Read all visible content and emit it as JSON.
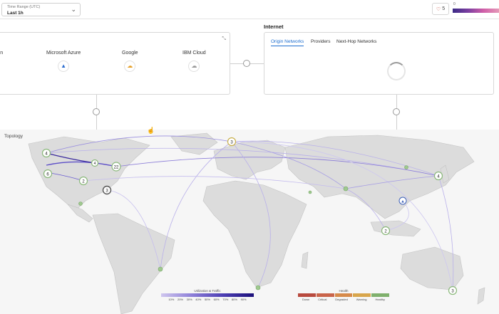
{
  "header": {
    "time_range": {
      "label": "Time Range (UTC)",
      "value": "Last 1h"
    },
    "favorites_count": "5",
    "legend_start": "0"
  },
  "clouds": {
    "items": [
      {
        "name": "Amazon",
        "display": "azon"
      },
      {
        "name": "Microsoft Azure",
        "display": "Microsoft Azure"
      },
      {
        "name": "Google",
        "display": "Google"
      },
      {
        "name": "IBM Cloud",
        "display": "IBM Cloud"
      }
    ]
  },
  "internet": {
    "title": "Internet",
    "tabs": [
      "Origin Networks",
      "Providers",
      "Next-Hop Networks"
    ],
    "active_tab": "Origin Networks"
  },
  "topology": {
    "label": "Topology",
    "nodes": [
      {
        "label": "4",
        "color": "#8ab87a"
      },
      {
        "label": "3",
        "color": "#c9b04c"
      },
      {
        "label": "22",
        "color": "#8ab87a"
      },
      {
        "label": "2",
        "color": "#8ab87a"
      },
      {
        "label": "6",
        "color": "#8ab87a"
      },
      {
        "label": "3",
        "color": "#555555"
      },
      {
        "label": "4",
        "color": "#8ab87a"
      },
      {
        "label": "2",
        "color": "#8ab87a"
      },
      {
        "label": "3",
        "color": "#8ab87a"
      },
      {
        "label": "4",
        "color": "#8ab87a"
      }
    ]
  },
  "utilization_legend": {
    "title": "Utilization & Traffic",
    "ticks": [
      "10%",
      "20%",
      "30%",
      "40%",
      "50%",
      "60%",
      "70%",
      "80%",
      "90%"
    ]
  },
  "health_legend": {
    "title": "Health",
    "items": [
      {
        "label": "Down",
        "color": "#b84a3e"
      },
      {
        "label": "Critical",
        "color": "#c9644a"
      },
      {
        "label": "Degraded",
        "color": "#d68a4a"
      },
      {
        "label": "Warning",
        "color": "#d8a64c"
      },
      {
        "label": "Healthy",
        "color": "#7fb06c"
      }
    ]
  }
}
